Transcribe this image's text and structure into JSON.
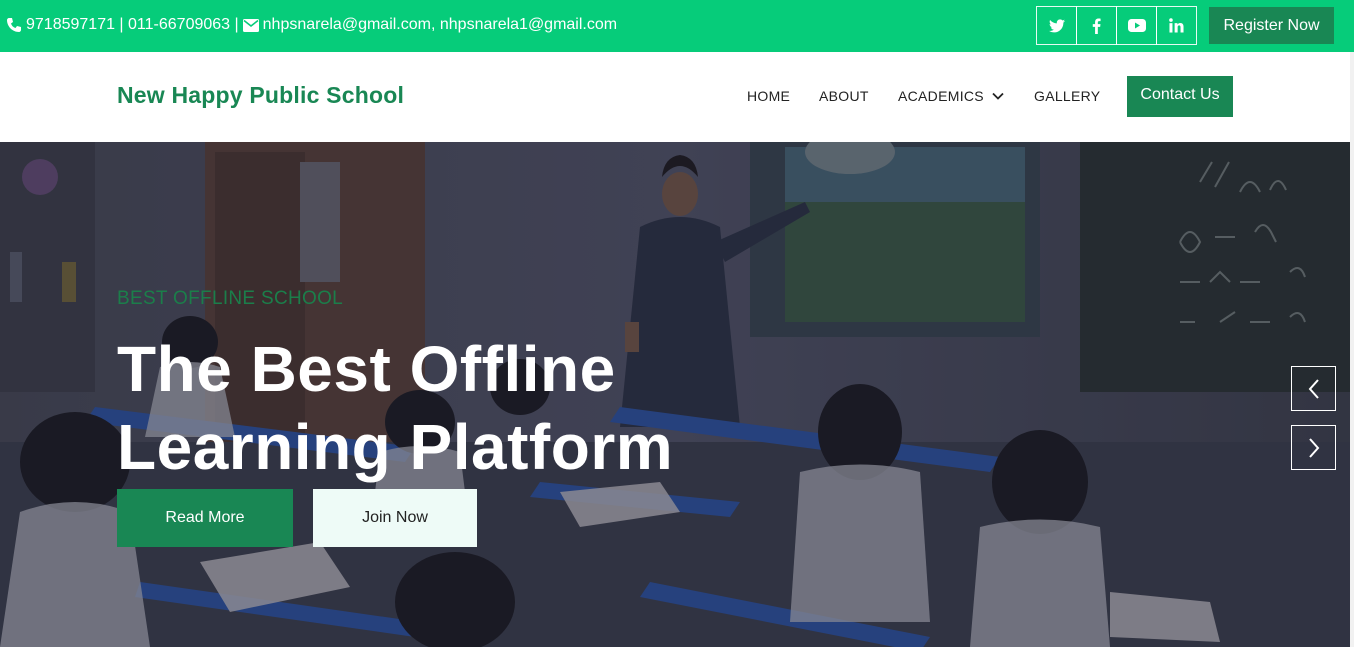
{
  "topbar": {
    "contact_text": "9718597171 | 011-66709063 | ",
    "email_text": "nhpsnarela@gmail.com, nhpsnarela1@gmail.com",
    "social": [
      "twitter",
      "facebook",
      "youtube",
      "linkedin"
    ],
    "register_label": "Register Now",
    "bg_color": "#06cc7a"
  },
  "navbar": {
    "brand": "New Happy Public School",
    "items": [
      "HOME",
      "ABOUT",
      "ACADEMICS",
      "GALLERY"
    ],
    "contact_label": "Contact Us",
    "accent_color": "#198754"
  },
  "hero": {
    "eyebrow": "BEST OFFLINE SCHOOL",
    "title_line1": "The Best Offline",
    "title_line2": "Learning Platform",
    "read_more_label": "Read More",
    "join_now_label": "Join Now",
    "background": "classroom photo with teacher pointing at smart board, students at blue desks"
  },
  "carousel": {
    "prev_icon": "chevron-left-icon",
    "next_icon": "chevron-right-icon"
  }
}
